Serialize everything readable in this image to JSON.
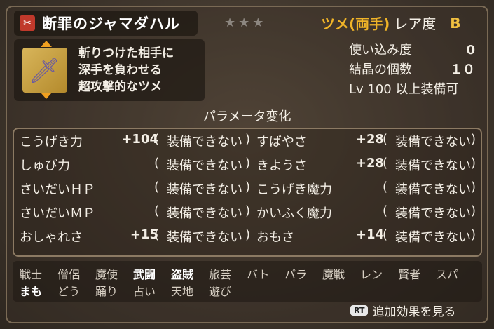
{
  "item": {
    "name": "断罪のジャマダハル",
    "stars": "★★★",
    "type": "ツメ(両手)",
    "rarity_label": "レア度",
    "rarity": "B",
    "description": [
      "斬りつけた相手に",
      "深手を負わせる",
      "超攻撃的なツメ"
    ]
  },
  "stats": [
    {
      "label": "使い込み度",
      "value": "0"
    },
    {
      "label": "結晶の個数",
      "value": "１０"
    },
    {
      "label": "Lv 100 以上装備可",
      "value": ""
    }
  ],
  "param_title": "パラメータ変化",
  "params": [
    {
      "left": {
        "name": "こうげき力",
        "value": "+104",
        "status": "装備できない"
      },
      "right": {
        "name": "すばやさ",
        "value": "+28",
        "status": "装備できない"
      }
    },
    {
      "left": {
        "name": "しゅび力",
        "value": "",
        "status": "装備できない"
      },
      "right": {
        "name": "きようさ",
        "value": "+28",
        "status": "装備できない"
      }
    },
    {
      "left": {
        "name": "さいだいＨＰ",
        "value": "",
        "status": "装備できない"
      },
      "right": {
        "name": "こうげき魔力",
        "value": "",
        "status": "装備できない"
      }
    },
    {
      "left": {
        "name": "さいだいＭＰ",
        "value": "",
        "status": "装備できない"
      },
      "right": {
        "name": "かいふく魔力",
        "value": "",
        "status": "装備できない"
      }
    },
    {
      "left": {
        "name": "おしゃれさ",
        "value": "+15",
        "status": "装備できない"
      },
      "right": {
        "name": "おもさ",
        "value": "+14",
        "status": "装備できない"
      }
    }
  ],
  "jobs_row1": [
    {
      "label": "戦士",
      "on": false
    },
    {
      "label": "僧侶",
      "on": false
    },
    {
      "label": "魔使",
      "on": false
    },
    {
      "label": "武闘",
      "on": true
    },
    {
      "label": "盗賊",
      "on": true
    },
    {
      "label": "旅芸",
      "on": false
    },
    {
      "label": "バト",
      "on": false
    },
    {
      "label": "パラ",
      "on": false
    },
    {
      "label": "魔戦",
      "on": false
    },
    {
      "label": "レン",
      "on": false
    },
    {
      "label": "賢者",
      "on": false
    },
    {
      "label": "スパ",
      "on": false
    }
  ],
  "jobs_row2": [
    {
      "label": "まも",
      "on": true
    },
    {
      "label": "どう",
      "on": false
    },
    {
      "label": "踊り",
      "on": false
    },
    {
      "label": "占い",
      "on": false
    },
    {
      "label": "天地",
      "on": false
    },
    {
      "label": "遊び",
      "on": false
    }
  ],
  "footer": {
    "button": "RT",
    "label": "追加効果を見る"
  }
}
